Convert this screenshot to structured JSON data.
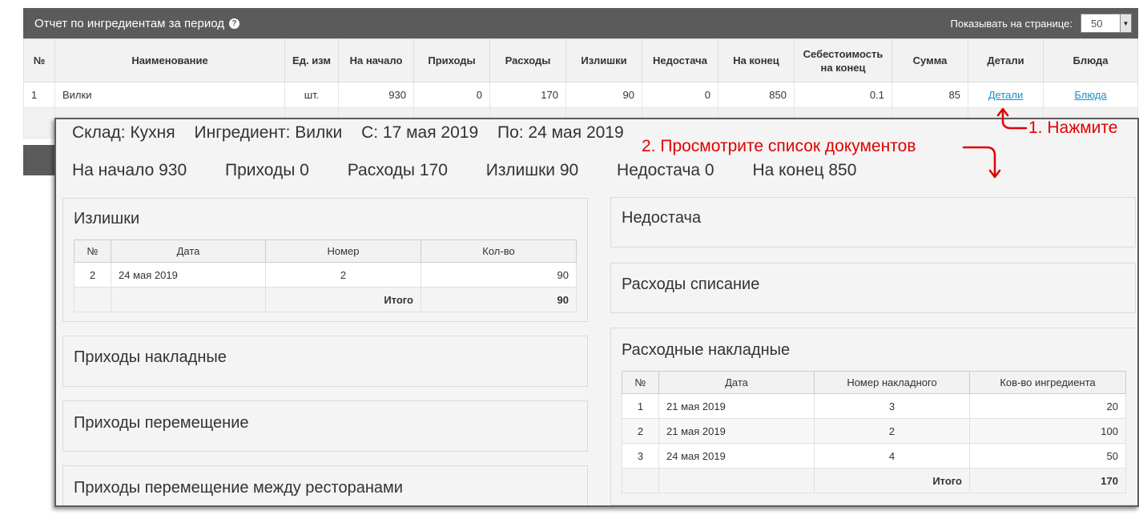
{
  "report": {
    "title": "Отчет по ингредиентам за период",
    "help_icon": "question-circle-icon",
    "per_page_label": "Показывать на странице:",
    "per_page_value": "50",
    "columns": [
      "№",
      "Наименование",
      "Ед. изм",
      "На начало",
      "Приходы",
      "Расходы",
      "Излишки",
      "Недостача",
      "На конец",
      "Себестоимость на конец",
      "Сумма",
      "Детали",
      "Блюда"
    ],
    "rows": [
      {
        "no": "1",
        "name": "Вилки",
        "unit": "шт.",
        "start": "930",
        "income": "0",
        "expense": "170",
        "surplus": "90",
        "shortage": "0",
        "end": "850",
        "cost": "0.1",
        "sum": "85",
        "details_link": "Детали",
        "dishes_link": "Блюда"
      }
    ]
  },
  "details": {
    "line1": [
      "Склад: Кухня",
      "Ингредиент: Вилки",
      "С: 17 мая 2019",
      "По: 24 мая 2019"
    ],
    "line2": [
      "На начало 930",
      "Приходы 0",
      "Расходы 170",
      "Излишки 90",
      "Недостача 0",
      "На конец 850"
    ],
    "surplus": {
      "title": "Излишки",
      "columns": [
        "№",
        "Дата",
        "Номер",
        "Кол-во"
      ],
      "rows": [
        {
          "no": "2",
          "date": "24 мая 2019",
          "number": "2",
          "qty": "90"
        }
      ],
      "total_label": "Итого",
      "total_value": "90"
    },
    "income_invoices_title": "Приходы накладные",
    "income_transfer_title": "Приходы перемещение",
    "income_transfer_rest_title": "Приходы перемещение между ресторанами",
    "shortage_title": "Недостача",
    "writeoff_title": "Расходы списание",
    "expense_invoices": {
      "title": "Расходные накладные",
      "columns": [
        "№",
        "Дата",
        "Номер накладного",
        "Ков-во ингредиента"
      ],
      "rows": [
        {
          "no": "1",
          "date": "21 мая 2019",
          "number": "3",
          "qty": "20"
        },
        {
          "no": "2",
          "date": "21 мая 2019",
          "number": "2",
          "qty": "100"
        },
        {
          "no": "3",
          "date": "24 мая 2019",
          "number": "4",
          "qty": "50"
        }
      ],
      "total_label": "Итого",
      "total_value": "170"
    }
  },
  "annotations": {
    "step1": "1. Нажмите",
    "step2": "2. Просмотрите список документов",
    "color": "#e00000"
  },
  "colors": {
    "header_bg": "#5b5b5b",
    "link": "#1a8fc9",
    "annotation": "#e00000"
  }
}
